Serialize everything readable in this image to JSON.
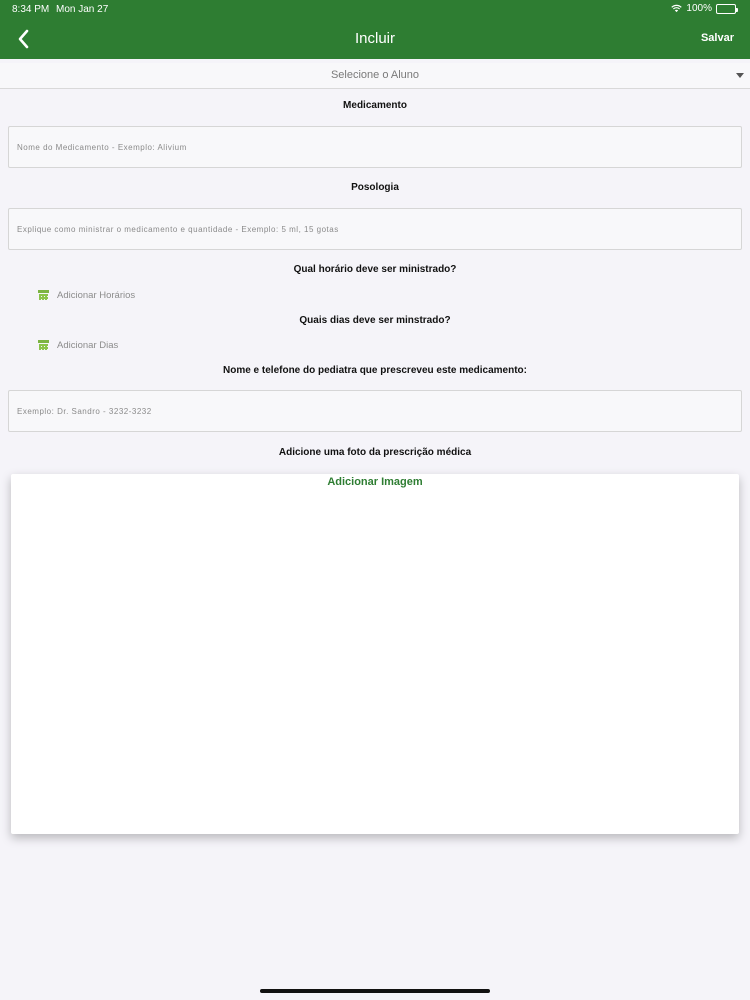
{
  "status_bar": {
    "time": "8:34 PM",
    "date": "Mon Jan 27",
    "battery": "100%"
  },
  "nav": {
    "title": "Incluir",
    "save_label": "Salvar"
  },
  "student_select": {
    "value": "Selecione o Aluno"
  },
  "medication": {
    "heading": "Medicamento",
    "placeholder": "Nome do Medicamento - Exemplo: Alivium"
  },
  "dosage": {
    "heading": "Posologia",
    "placeholder": "Explique como ministrar o medicamento e quantidade - Exemplo: 5 ml, 15 gotas"
  },
  "schedule": {
    "hours_heading": "Qual horário deve ser ministrado?",
    "hours_button": "Adicionar Horários",
    "days_heading": "Quais dias deve ser minstrado?",
    "days_button": "Adicionar Dias"
  },
  "pediatrician": {
    "heading": "Nome e telefone do pediatra que prescreveu este medicamento:",
    "placeholder": "Exemplo: Dr. Sandro - 3232-3232"
  },
  "prescription": {
    "heading": "Adicione uma foto da prescrição médica",
    "add_image_label": "Adicionar Imagem"
  },
  "colors": {
    "primary": "#2e7d32",
    "icon_green": "#7cb342"
  }
}
